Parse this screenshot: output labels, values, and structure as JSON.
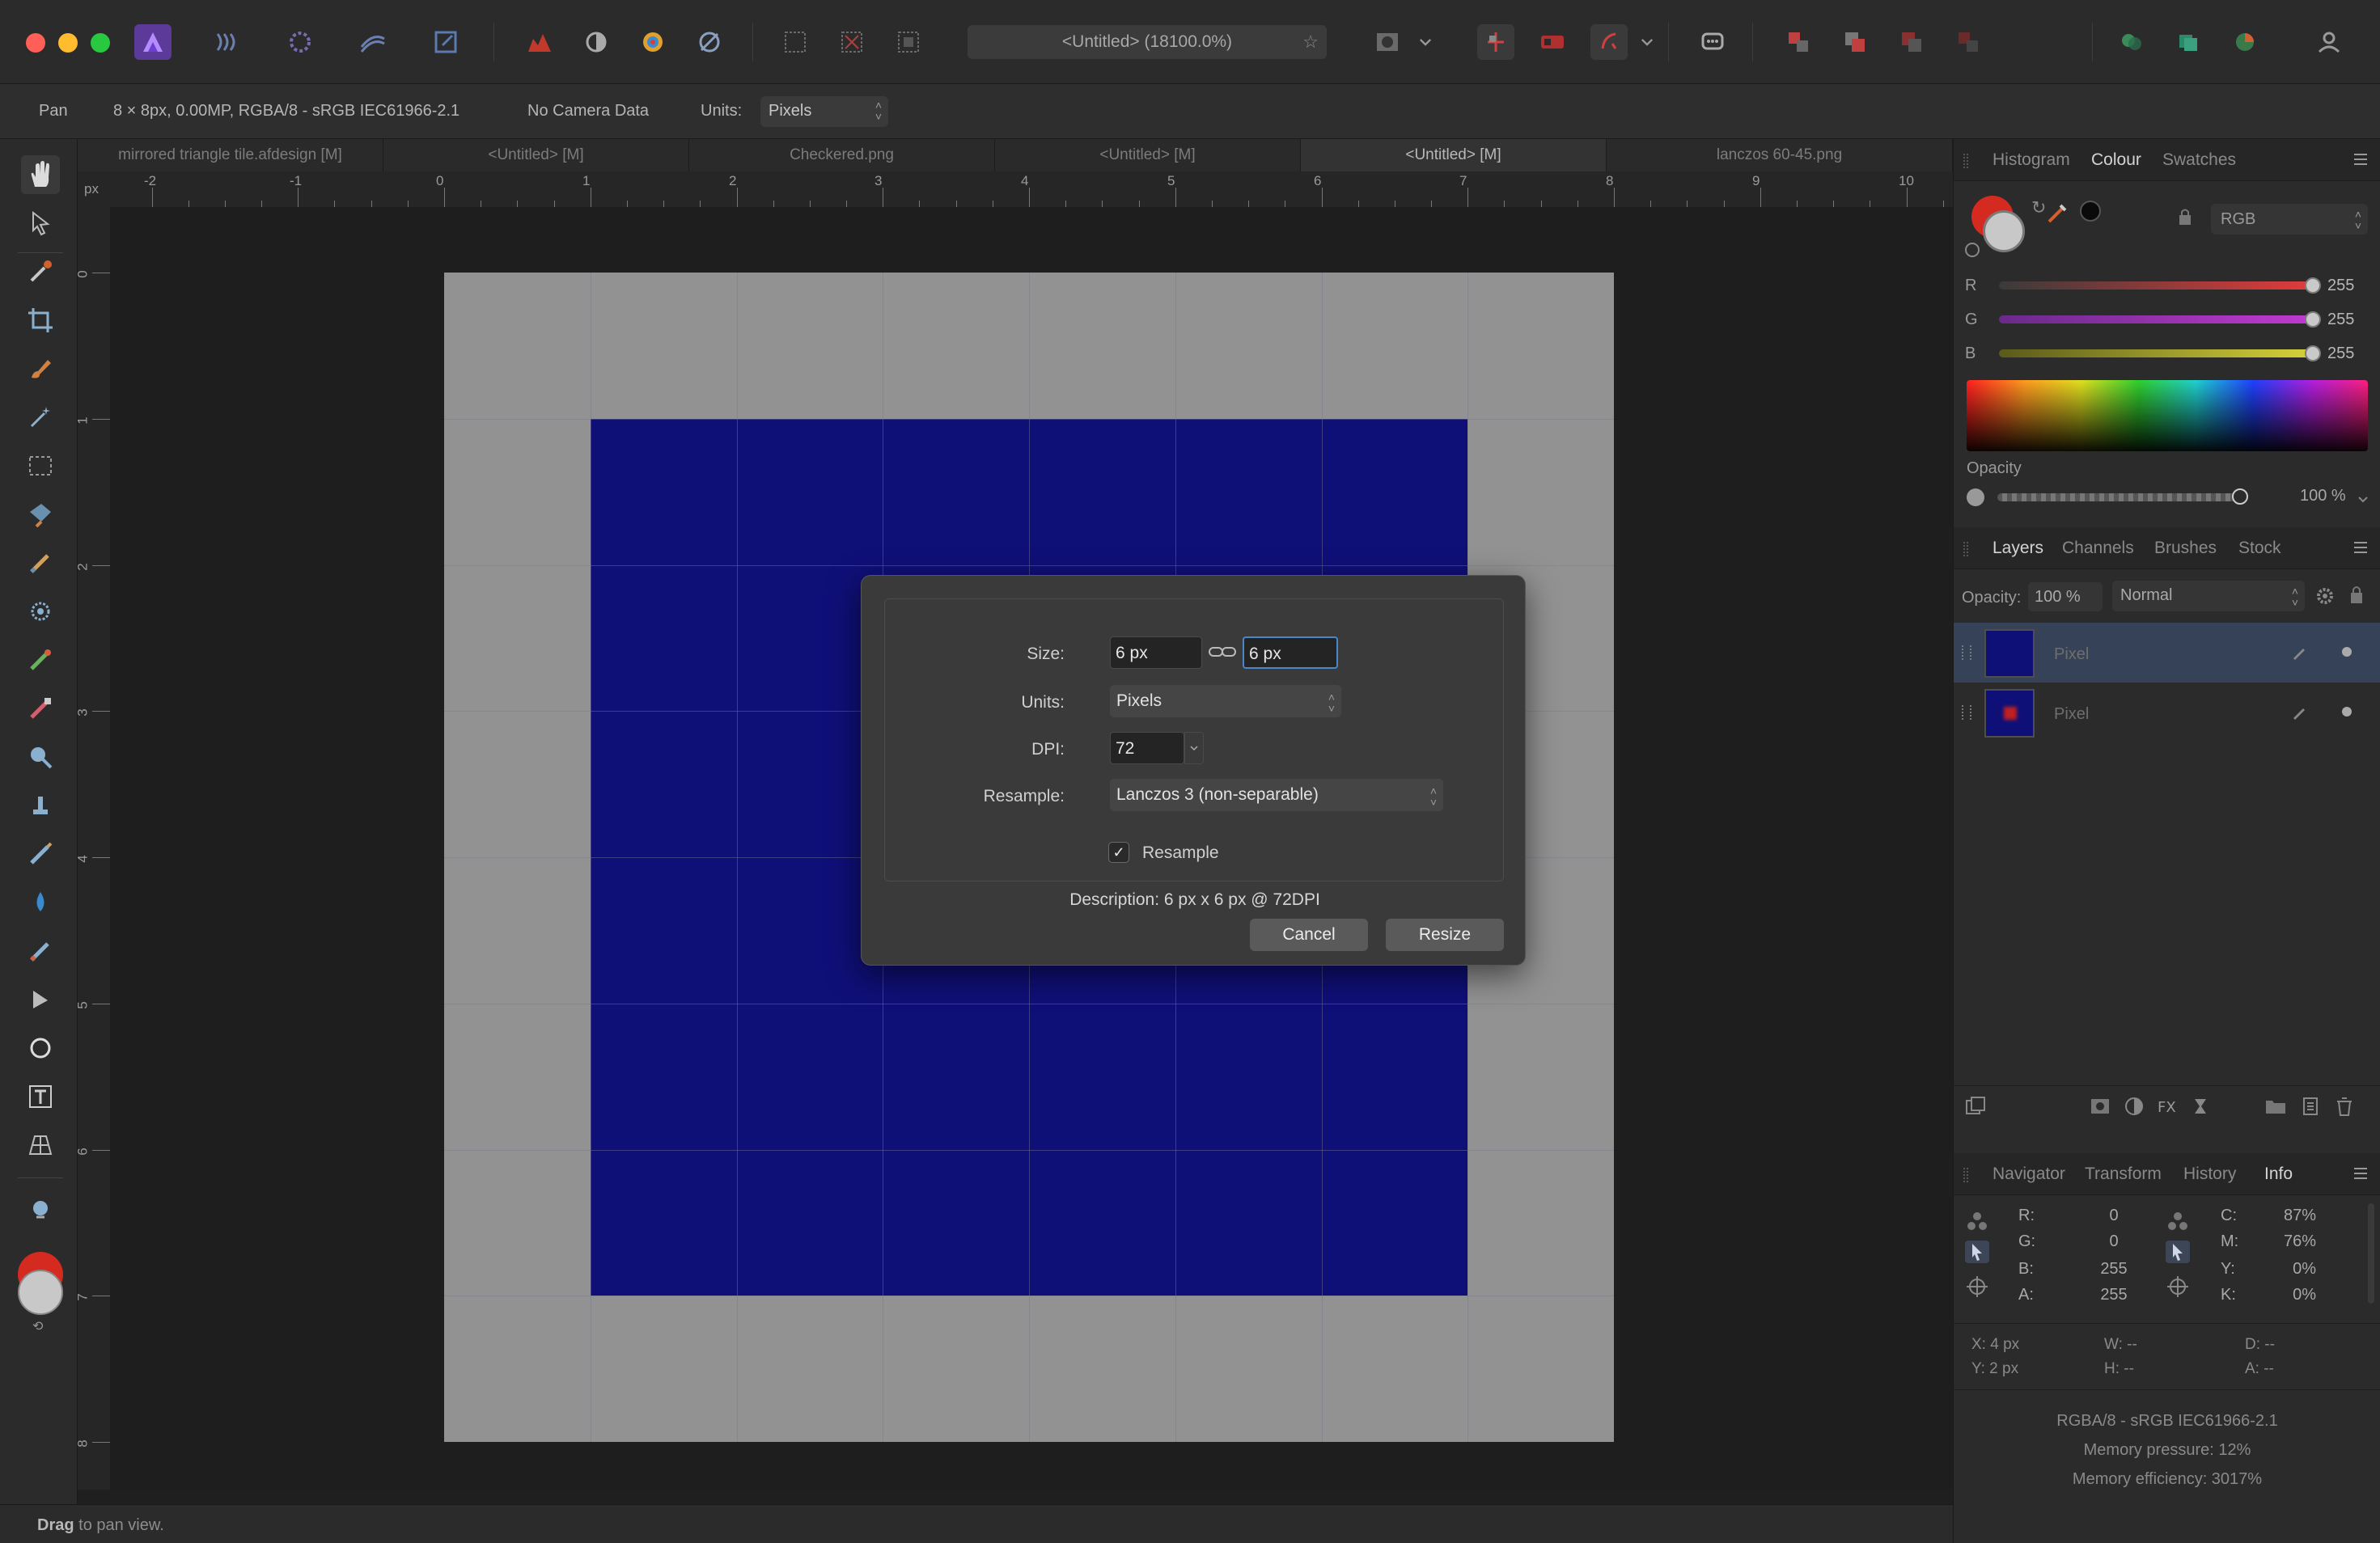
{
  "toolbar": {
    "document_title": "<Untitled> (18100.0%)"
  },
  "context": {
    "tool_name": "Pan",
    "doc_info": "8 × 8px, 0.00MP, RGBA/8 - sRGB IEC61966-2.1",
    "camera": "No Camera Data",
    "units_label": "Units:",
    "units_value": "Pixels"
  },
  "doc_tabs": [
    {
      "label": "mirrored triangle tile.afdesign [M]"
    },
    {
      "label": "<Untitled> [M]"
    },
    {
      "label": "Checkered.png"
    },
    {
      "label": "<Untitled> [M]"
    },
    {
      "label": "<Untitled> [M]",
      "active": true
    },
    {
      "label": "lanczos 60-45.png"
    }
  ],
  "ruler": {
    "unit": "px",
    "top_labels": [
      "-2",
      "-1",
      "0",
      "1",
      "2",
      "3",
      "4",
      "5",
      "6",
      "7",
      "8",
      "9",
      "10"
    ],
    "left_labels": [
      "0",
      "1",
      "2",
      "3",
      "4",
      "5",
      "6",
      "7",
      "8"
    ]
  },
  "colour_panel": {
    "tabs": [
      "Histogram",
      "Colour",
      "Swatches"
    ],
    "active_tab": "Colour",
    "model": "RGB",
    "channels": [
      {
        "label": "R",
        "value": "255",
        "color_from": "#3a3a3a",
        "color_to": "#e33b3b"
      },
      {
        "label": "G",
        "value": "255",
        "color_from": "#6a2a8a",
        "color_to": "#c03ad0"
      },
      {
        "label": "B",
        "value": "255",
        "color_from": "#5a5a1a",
        "color_to": "#d6d23a"
      }
    ],
    "opacity_label": "Opacity",
    "opacity_value": "100 %",
    "fill_color": "#d42a1f",
    "stroke_color": "#c8c8c8"
  },
  "layers_panel": {
    "tabs": [
      "Layers",
      "Channels",
      "Brushes",
      "Stock"
    ],
    "active_tab": "Layers",
    "opacity_label": "Opacity:",
    "opacity_value": "100 %",
    "blend_mode": "Normal",
    "layers": [
      {
        "name": "Pixel",
        "selected": true
      },
      {
        "name": "Pixel",
        "selected": false
      }
    ]
  },
  "info_panel": {
    "tabs": [
      "Navigator",
      "Transform",
      "History",
      "Info"
    ],
    "active_tab": "Info",
    "rgb": [
      {
        "label": "R:",
        "value": "0"
      },
      {
        "label": "G:",
        "value": "0"
      },
      {
        "label": "B:",
        "value": "255"
      },
      {
        "label": "A:",
        "value": "255"
      }
    ],
    "cmyk": [
      {
        "label": "C:",
        "value": "87%"
      },
      {
        "label": "M:",
        "value": "76%"
      },
      {
        "label": "Y:",
        "value": "0%"
      },
      {
        "label": "K:",
        "value": "0%"
      }
    ],
    "x": "X: 4 px",
    "y": "Y: 2 px",
    "w": "W: --",
    "h": "H: --",
    "d": "D: --",
    "a": "A: --",
    "profile": "RGBA/8 - sRGB IEC61966-2.1",
    "memory_pressure": "Memory pressure: 12%",
    "memory_efficiency": "Memory efficiency: 3017%"
  },
  "dialog": {
    "size_label": "Size:",
    "width_value": "6 px",
    "height_value": "6 px",
    "units_label": "Units:",
    "units_value": "Pixels",
    "dpi_label": "DPI:",
    "dpi_value": "72",
    "resample_label": "Resample:",
    "resample_value": "Lanczos 3 (non-separable)",
    "resample_checkbox_label": "Resample",
    "resample_checked": true,
    "description": "Description: 6 px x 6 px @ 72DPI",
    "cancel_label": "Cancel",
    "resize_label": "Resize"
  },
  "status": {
    "bold": "Drag",
    "rest": " to pan view."
  },
  "canvas": {
    "background_color": "#929292",
    "square_color": "#0f0f78"
  }
}
